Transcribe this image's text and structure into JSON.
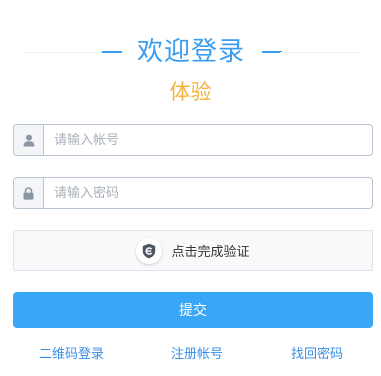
{
  "header": {
    "title": "欢迎登录",
    "subtitle": "体验"
  },
  "form": {
    "username": {
      "icon": "user-icon",
      "placeholder": "请输入帐号",
      "value": ""
    },
    "password": {
      "icon": "lock-icon",
      "placeholder": "请输入密码",
      "value": ""
    },
    "captcha": {
      "icon": "shield-icon",
      "label": "点击完成验证"
    },
    "submit_label": "提交"
  },
  "links": {
    "qr_login": "二维码登录",
    "register": "注册帐号",
    "forgot_password": "找回密码"
  },
  "colors": {
    "accent": "#3a9cf0",
    "subtitle": "#f0b43c",
    "button": "#3aa7f6",
    "link": "#3a8ee6"
  }
}
